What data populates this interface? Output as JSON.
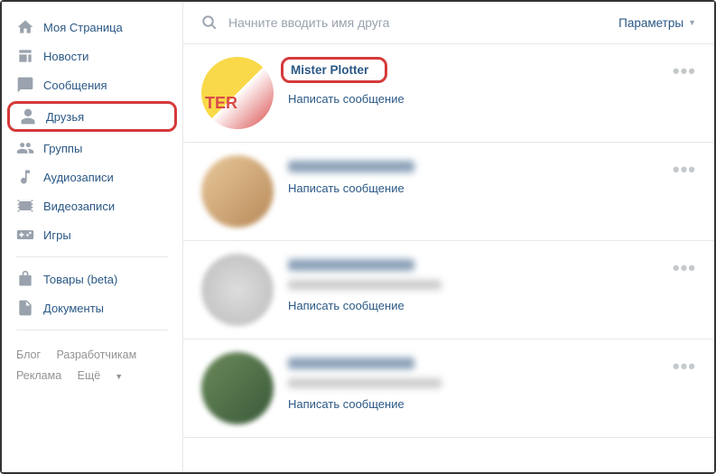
{
  "sidebar": {
    "items": [
      {
        "label": "Моя Страница",
        "icon": "home"
      },
      {
        "label": "Новости",
        "icon": "news"
      },
      {
        "label": "Сообщения",
        "icon": "messages"
      },
      {
        "label": "Друзья",
        "icon": "friends",
        "highlighted": true
      },
      {
        "label": "Группы",
        "icon": "groups"
      },
      {
        "label": "Аудиозаписи",
        "icon": "audio"
      },
      {
        "label": "Видеозаписи",
        "icon": "video"
      },
      {
        "label": "Игры",
        "icon": "games"
      }
    ],
    "items2": [
      {
        "label": "Товары (beta)",
        "icon": "market"
      },
      {
        "label": "Документы",
        "icon": "docs"
      }
    ],
    "footer": {
      "blog": "Блог",
      "devs": "Разработчикам",
      "ads": "Реклама",
      "more": "Ещё"
    }
  },
  "search": {
    "placeholder": "Начните вводить имя друга",
    "params_label": "Параметры"
  },
  "friends": [
    {
      "name": "Mister Plotter",
      "msg": "Написать сообщение",
      "highlighted": true
    },
    {
      "msg": "Написать сообщение"
    },
    {
      "msg": "Написать сообщение"
    },
    {
      "msg": "Написать сообщение"
    }
  ]
}
